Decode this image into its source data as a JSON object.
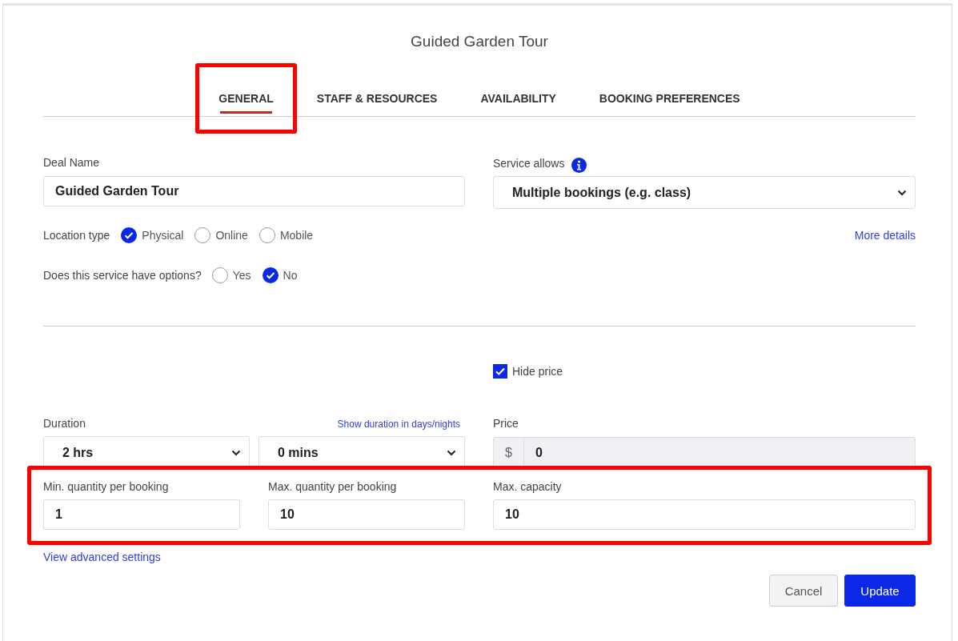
{
  "dialog": {
    "title": "Guided Garden Tour"
  },
  "tabs": [
    {
      "label": "GENERAL",
      "selected": true,
      "highlighted": true
    },
    {
      "label": "STAFF & RESOURCES",
      "selected": false,
      "highlighted": false
    },
    {
      "label": "AVAILABILITY",
      "selected": false,
      "highlighted": false
    },
    {
      "label": "BOOKING PREFERENCES",
      "selected": false,
      "highlighted": false
    }
  ],
  "deal_name": {
    "label": "Deal Name",
    "value": "Guided Garden Tour"
  },
  "service_allows": {
    "label": "Service allows",
    "value": "Multiple bookings (e.g. class)"
  },
  "location_type": {
    "label": "Location type",
    "options": [
      {
        "label": "Physical",
        "selected": true
      },
      {
        "label": "Online",
        "selected": false
      },
      {
        "label": "Mobile",
        "selected": false
      }
    ]
  },
  "more_details_link": "More details",
  "has_options": {
    "label": "Does this service have options?",
    "options": [
      {
        "label": "Yes",
        "selected": false
      },
      {
        "label": "No",
        "selected": true
      }
    ]
  },
  "hide_price": {
    "label": "Hide price",
    "checked": true
  },
  "duration": {
    "label": "Duration",
    "link": "Show duration in days/nights",
    "hours": "2 hrs",
    "minutes": "0 mins"
  },
  "price": {
    "label": "Price",
    "currency": "$",
    "value": "0",
    "disabled": true
  },
  "quantities": {
    "highlighted": true,
    "fields": [
      {
        "label": "Min. quantity per booking",
        "value": "1"
      },
      {
        "label": "Max. quantity per booking",
        "value": "10"
      },
      {
        "label": "Max. capacity",
        "value": "10"
      }
    ]
  },
  "advanced_link": "View advanced settings",
  "buttons": [
    {
      "label": "Cancel",
      "kind": "secondary"
    },
    {
      "label": "Update",
      "kind": "primary"
    }
  ]
}
